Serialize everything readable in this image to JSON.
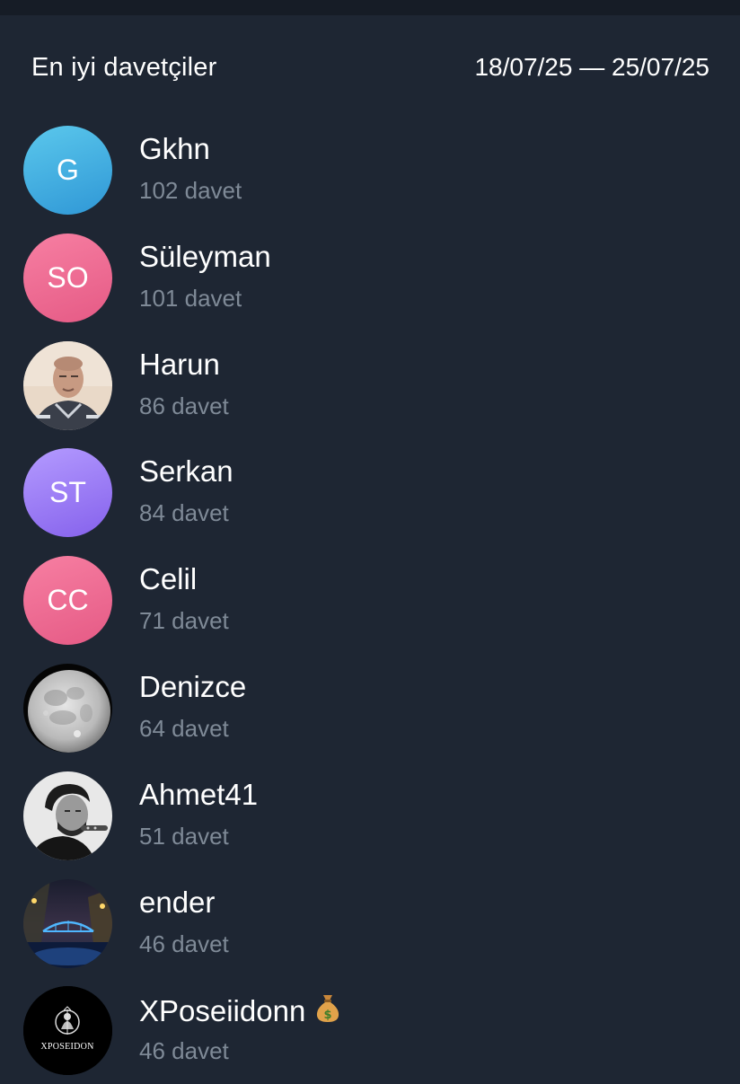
{
  "header": {
    "title": "En iyi davetçiler",
    "date_range": "18/07/25 — 25/07/25"
  },
  "inviters": [
    {
      "name": "Gkhn",
      "count": "102 davet",
      "initials": "G",
      "avatar_type": "initials",
      "colors": [
        "#5bc8ec",
        "#2f97d6"
      ]
    },
    {
      "name": "Süleyman",
      "count": "101 davet",
      "initials": "SO",
      "avatar_type": "initials",
      "colors": [
        "#f77fa2",
        "#e55a85"
      ]
    },
    {
      "name": "Harun",
      "count": "86 davet",
      "avatar_type": "photo-man-portrait"
    },
    {
      "name": "Serkan",
      "count": "84 davet",
      "initials": "ST",
      "avatar_type": "initials",
      "colors": [
        "#b49bff",
        "#8561ec"
      ]
    },
    {
      "name": "Celil",
      "count": "71 davet",
      "initials": "CC",
      "avatar_type": "initials",
      "colors": [
        "#f77fa2",
        "#e55a85"
      ]
    },
    {
      "name": "Denizce",
      "count": "64 davet",
      "avatar_type": "photo-full-moon"
    },
    {
      "name": "Ahmet41",
      "count": "51 davet",
      "avatar_type": "photo-man-grayscale"
    },
    {
      "name": "ender",
      "count": "46 davet",
      "avatar_type": "photo-night-bridge"
    },
    {
      "name": "XPoseiidonn",
      "count": "46 davet",
      "avatar_type": "logo-xposeidon",
      "logo_text": "XPOSEIDON",
      "badge_icon": "money-bag-icon"
    }
  ]
}
